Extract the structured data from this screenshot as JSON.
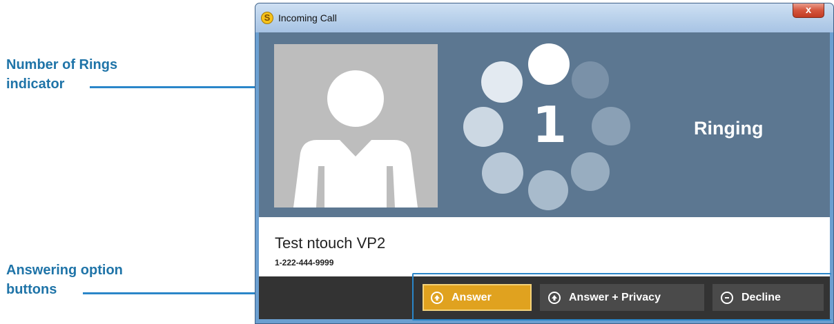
{
  "annotations": {
    "rings_line1": "Number of Rings",
    "rings_line2": "indicator",
    "buttons_line1": "Answering option",
    "buttons_line2": "buttons"
  },
  "window": {
    "title": "Incoming Call",
    "logo_letter": "S",
    "close_label": "x"
  },
  "call": {
    "ring_count": "1",
    "status": "Ringing",
    "caller_name": "Test ntouch VP2",
    "caller_number": "1-222-444-9999"
  },
  "buttons": {
    "answer": "Answer",
    "answer_privacy": "Answer + Privacy",
    "decline": "Decline"
  },
  "colors": {
    "callout_text": "#1f74a8",
    "callout_line": "#2a86c9",
    "panel_blue": "#5c7791",
    "answer_gold": "#e0a21f",
    "button_dark": "#4a4a4a",
    "bottom_bar": "#333333"
  },
  "icons": {
    "app": "app-logo-icon",
    "close": "close-icon",
    "avatar": "person-silhouette-icon",
    "answer": "arrow-up-circle-icon",
    "answer_privacy": "arrow-up-circle-icon",
    "decline": "minus-circle-icon"
  }
}
